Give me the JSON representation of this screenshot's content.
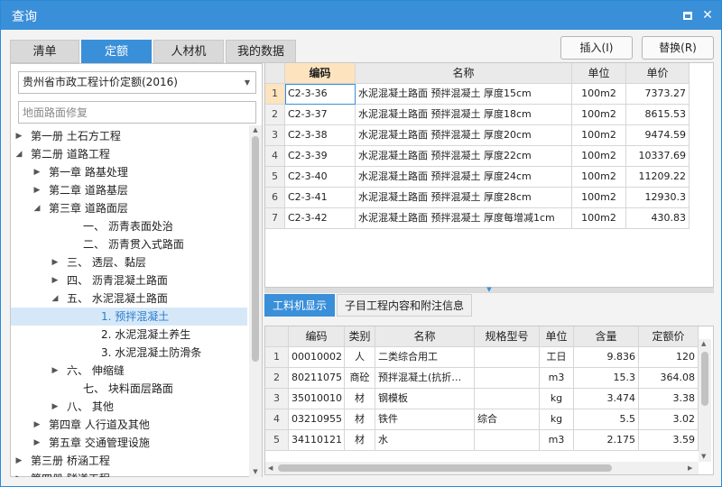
{
  "window": {
    "title": "查询"
  },
  "tabs": [
    "清单",
    "定额",
    "人材机",
    "我的数据"
  ],
  "left": {
    "combo_value": "贵州省市政工程计价定额(2016)",
    "search_placeholder": "地面路面修复",
    "tree": [
      {
        "label": "第一册 土石方工程",
        "toggle": "▶"
      },
      {
        "label": "第二册 道路工程",
        "toggle": "◢"
      },
      {
        "label": "第一章 路基处理",
        "toggle": "▶"
      },
      {
        "label": "第二章 道路基层",
        "toggle": "▶"
      },
      {
        "label": "第三章 道路面层",
        "toggle": "◢"
      },
      {
        "label": "一、 沥青表面处治",
        "toggle": ""
      },
      {
        "label": "二、 沥青贯入式路面",
        "toggle": ""
      },
      {
        "label": "三、 透层、黏层",
        "toggle": "▶"
      },
      {
        "label": "四、 沥青混凝土路面",
        "toggle": "▶"
      },
      {
        "label": "五、 水泥混凝土路面",
        "toggle": "◢"
      },
      {
        "label": "1. 预拌混凝土",
        "toggle": ""
      },
      {
        "label": "2. 水泥混凝土养生",
        "toggle": ""
      },
      {
        "label": "3. 水泥混凝土防滑条",
        "toggle": ""
      },
      {
        "label": "六、 伸缩缝",
        "toggle": "▶"
      },
      {
        "label": "七、 块料面层路面",
        "toggle": ""
      },
      {
        "label": "八、 其他",
        "toggle": "▶"
      },
      {
        "label": "第四章 人行道及其他",
        "toggle": "▶"
      },
      {
        "label": "第五章 交通管理设施",
        "toggle": "▶"
      },
      {
        "label": "第三册 桥涵工程",
        "toggle": "▶"
      },
      {
        "label": "第四册 隧道工程",
        "toggle": "▶"
      }
    ]
  },
  "buttons": {
    "insert": "插入(I)",
    "replace": "替换(R)"
  },
  "main_grid": {
    "headers": [
      "",
      "编码",
      "名称",
      "单位",
      "单价"
    ],
    "rows": [
      [
        "1",
        "C2-3-36",
        "水泥混凝土路面 预拌混凝土 厚度15cm",
        "100m2",
        "7373.27"
      ],
      [
        "2",
        "C2-3-37",
        "水泥混凝土路面 预拌混凝土 厚度18cm",
        "100m2",
        "8615.53"
      ],
      [
        "3",
        "C2-3-38",
        "水泥混凝土路面 预拌混凝土 厚度20cm",
        "100m2",
        "9474.59"
      ],
      [
        "4",
        "C2-3-39",
        "水泥混凝土路面 预拌混凝土 厚度22cm",
        "100m2",
        "10337.69"
      ],
      [
        "5",
        "C2-3-40",
        "水泥混凝土路面 预拌混凝土 厚度24cm",
        "100m2",
        "11209.22"
      ],
      [
        "6",
        "C2-3-41",
        "水泥混凝土路面 预拌混凝土 厚度28cm",
        "100m2",
        "12930.3"
      ],
      [
        "7",
        "C2-3-42",
        "水泥混凝土路面 预拌混凝土 厚度每增减1cm",
        "100m2",
        "430.83"
      ]
    ]
  },
  "bottom_tabs": [
    "工料机显示",
    "子目工程内容和附注信息"
  ],
  "detail_grid": {
    "headers": [
      "",
      "编码",
      "类别",
      "名称",
      "规格型号",
      "单位",
      "含量",
      "定额价"
    ],
    "rows": [
      [
        "1",
        "00010002",
        "人",
        "二类综合用工",
        "",
        "工日",
        "9.836",
        "120"
      ],
      [
        "2",
        "80211075",
        "商砼",
        "预拌混凝土(抗折…",
        "",
        "m3",
        "15.3",
        "364.08"
      ],
      [
        "3",
        "35010010",
        "材",
        "钢模板",
        "",
        "kg",
        "3.474",
        "3.38"
      ],
      [
        "4",
        "03210955",
        "材",
        "铁件",
        "综合",
        "kg",
        "5.5",
        "3.02"
      ],
      [
        "5",
        "34110121",
        "材",
        "水",
        "",
        "m3",
        "2.175",
        "3.59"
      ]
    ]
  }
}
